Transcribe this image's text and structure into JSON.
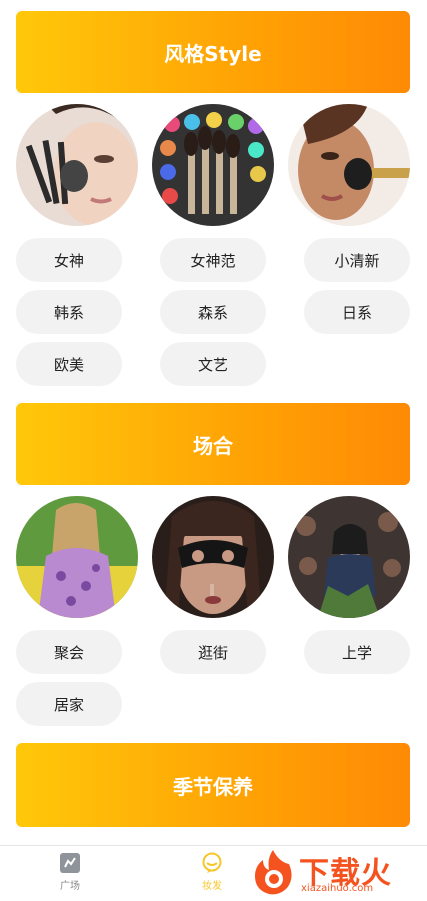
{
  "sections": [
    {
      "title": "风格Style",
      "images": [
        "makeup-brush-face",
        "colorful-brush-set",
        "blush-application"
      ],
      "tags": [
        "女神",
        "女神范",
        "小清新",
        "韩系",
        "森系",
        "日系",
        "欧美",
        "文艺"
      ]
    },
    {
      "title": "场合",
      "images": [
        "festival-woman",
        "lace-mask-woman",
        "party-woman"
      ],
      "tags": [
        "聚会",
        "逛街",
        "上学",
        "居家"
      ]
    },
    {
      "title": "季节保养"
    }
  ],
  "tabbar": {
    "tabs": [
      {
        "label": "广场",
        "icon": "square-icon"
      },
      {
        "label": "妆发",
        "icon": "bubble-icon"
      }
    ]
  },
  "watermark": {
    "text": "下载火",
    "sub": "xiazaihuo.com"
  },
  "colors": {
    "accent_start": "#ffc80a",
    "accent_end": "#ff8a05",
    "tag_bg": "#f2f2f2",
    "tab_active": "#f7c62a"
  }
}
